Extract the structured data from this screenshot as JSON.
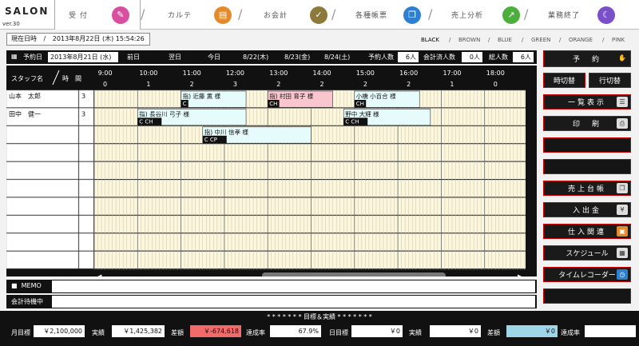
{
  "app": {
    "title": "SALON",
    "version": "ver.30"
  },
  "tabs": [
    {
      "label": "受 付",
      "icon": "reception-icon",
      "color": "#d94fa0",
      "active": true
    },
    {
      "label": "カルテ",
      "icon": "chart-record-icon",
      "color": "#e58a2a"
    },
    {
      "label": "お会計",
      "icon": "checkout-icon",
      "color": "#e4a21f"
    },
    {
      "label": "各種帳票",
      "icon": "reports-icon",
      "color": "#8c7a3a"
    },
    {
      "label": "売上分析",
      "icon": "sales-analysis-icon",
      "color": "#2f7fd1"
    },
    {
      "label": "業務終了",
      "icon": "finish-icon",
      "color": "#4caf3c"
    },
    {
      "label": "",
      "icon": "moon-icon",
      "color": "#7b4fc9"
    }
  ],
  "now": {
    "label": "現在日時",
    "value": "2013年8月22日 (木)  15:54:26"
  },
  "themes": [
    "BLACK",
    "BROWN",
    "BLUE",
    "GREEN",
    "ORANGE",
    "PINK"
  ],
  "toolbar": {
    "reserve_day_label": "予約日",
    "reserve_day_value": "2013年8月21日 (水)",
    "prev_day": "前日",
    "next_day": "翌日",
    "today": "今日",
    "day1": "8/22(木)",
    "day2": "8/23(金)",
    "day3": "8/24(土)",
    "reserve_count_label": "予約人数",
    "reserve_count_value": "6人",
    "paid_count_label": "会計済人数",
    "paid_count_value": "0人",
    "total_label": "総人数",
    "total_value": "6人"
  },
  "grid": {
    "staff_header": "スタッフ名",
    "time_header": "時　間",
    "hours": [
      "9:00",
      "10:00",
      "11:00",
      "12:00",
      "13:00",
      "14:00",
      "15:00",
      "16:00",
      "17:00",
      "18:00"
    ],
    "counts": [
      "0",
      "1",
      "2",
      "3",
      "2",
      "2",
      "2",
      "2",
      "1",
      "0"
    ],
    "staff": [
      {
        "name": "山本　太郎",
        "count": "3"
      },
      {
        "name": "田中　健一",
        "count": "3"
      },
      {
        "name": "",
        "count": ""
      },
      {
        "name": "",
        "count": ""
      },
      {
        "name": "",
        "count": ""
      },
      {
        "name": "",
        "count": ""
      },
      {
        "name": "",
        "count": ""
      },
      {
        "name": "",
        "count": ""
      },
      {
        "name": "",
        "count": ""
      },
      {
        "name": "",
        "count": ""
      }
    ],
    "appointments": [
      {
        "row": 0,
        "start": "11:00",
        "end": "12:30",
        "title": "指) 近藤 薫 様",
        "tag": "C",
        "color": "#e6fbfb"
      },
      {
        "row": 0,
        "start": "13:00",
        "end": "14:30",
        "title": "指) 村田 育子 様",
        "tag": "CH",
        "color": "#f9c6cf"
      },
      {
        "row": 0,
        "start": "15:00",
        "end": "16:30",
        "title": "小橋 小百合 様",
        "tag": "CH",
        "color": "#e6fbfb"
      },
      {
        "row": 1,
        "start": "10:00",
        "end": "12:30",
        "title": "指) 長谷川 弓子 様",
        "tag": "C  CH",
        "color": "#e6fbfb"
      },
      {
        "row": 1,
        "start": "14:45",
        "end": "16:45",
        "title": "野中 大輝 様",
        "tag": "C  CH",
        "color": "#e6fbfb"
      },
      {
        "row": 2,
        "start": "11:30",
        "end": "14:00",
        "title": "指) 中川 信孝 様",
        "tag": "C  CP",
        "color": "#e6fbfb"
      }
    ]
  },
  "right_buttons": [
    {
      "label": "予　約",
      "icon": "reserve-icon",
      "tall": true
    },
    {
      "label": "時切替",
      "icon": "",
      "half": "left"
    },
    {
      "label": "行切替",
      "icon": "",
      "half": "right"
    },
    {
      "label": "一覧表示",
      "icon": "list-view-icon"
    },
    {
      "label": "印　刷",
      "icon": "printer-icon"
    },
    {
      "label": "",
      "icon": ""
    },
    {
      "label": "",
      "icon": ""
    },
    {
      "label": "売上台帳",
      "icon": "ledger-icon"
    },
    {
      "label": "入出金",
      "icon": "cash-icon"
    },
    {
      "label": "仕入関連",
      "icon": "purchase-icon"
    },
    {
      "label": "スケジュール",
      "icon": "schedule-icon"
    },
    {
      "label": "タイムレコーダー",
      "icon": "time-recorder-icon"
    },
    {
      "label": "",
      "icon": ""
    }
  ],
  "memo": {
    "label": "MEMO",
    "value": ""
  },
  "pending": {
    "label": "会計待機中",
    "value": ""
  },
  "bottom": {
    "title": "* * * * * * *  目標＆実績  * * * * * * *",
    "monthly_goal_label": "月目標",
    "monthly_goal_value": "￥2,100,000",
    "monthly_actual_label": "実績",
    "monthly_actual_value": "￥1,425,382",
    "monthly_diff_label": "差額",
    "monthly_diff_value": "￥-674,618",
    "monthly_rate_label": "達成率",
    "monthly_rate_value": "67.9%",
    "daily_goal_label": "日目標",
    "daily_goal_value": "￥0",
    "daily_actual_label": "実績",
    "daily_actual_value": "￥0",
    "daily_diff_label": "差額",
    "daily_diff_value": "￥0",
    "daily_rate_label": "達成率",
    "daily_rate_value": ""
  },
  "colors": {
    "grid_bg": "#fbf6dc",
    "header_bg": "#111111",
    "negative": "#f26b6b",
    "diff_daily": "#9fd6e8",
    "button_border": "#cc0000"
  }
}
